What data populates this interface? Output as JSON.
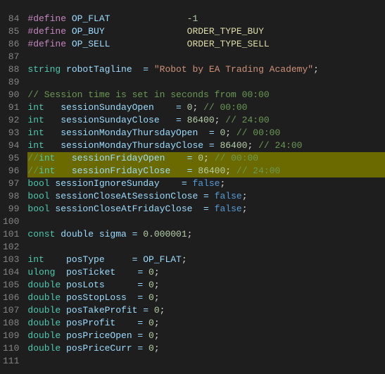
{
  "editor": {
    "background": "#1e1e1e",
    "lines": [
      {
        "num": "",
        "content": []
      },
      {
        "num": "84",
        "content": [
          {
            "t": "#define",
            "c": "preprocessor"
          },
          {
            "t": " OP_FLAT",
            "c": "macro-name"
          },
          {
            "t": "              ",
            "c": ""
          },
          {
            "t": "-1",
            "c": "macro-val"
          }
        ]
      },
      {
        "num": "85",
        "content": [
          {
            "t": "#define",
            "c": "preprocessor"
          },
          {
            "t": " OP_BUY",
            "c": "macro-name"
          },
          {
            "t": "               ",
            "c": ""
          },
          {
            "t": "ORDER_TYPE_BUY",
            "c": "order-type"
          }
        ]
      },
      {
        "num": "86",
        "content": [
          {
            "t": "#define",
            "c": "preprocessor"
          },
          {
            "t": " OP_SELL",
            "c": "macro-name"
          },
          {
            "t": "              ",
            "c": ""
          },
          {
            "t": "ORDER_TYPE_SELL",
            "c": "order-type"
          }
        ]
      },
      {
        "num": "87",
        "content": []
      },
      {
        "num": "88",
        "content": [
          {
            "t": "string",
            "c": "kw-string"
          },
          {
            "t": " robotTagline  = ",
            "c": "var"
          },
          {
            "t": "\"Robot by EA Trading Academy\"",
            "c": "str"
          },
          {
            "t": ";",
            "c": "punct"
          }
        ]
      },
      {
        "num": "89",
        "content": []
      },
      {
        "num": "90",
        "content": [
          {
            "t": "// Session time is set in seconds from 00:00",
            "c": "comment"
          }
        ]
      },
      {
        "num": "91",
        "content": [
          {
            "t": "int",
            "c": "kw-int"
          },
          {
            "t": "   sessionSundayOpen    = ",
            "c": "var"
          },
          {
            "t": "0",
            "c": "num"
          },
          {
            "t": "; ",
            "c": "punct"
          },
          {
            "t": "// 00:00",
            "c": "comment"
          }
        ]
      },
      {
        "num": "92",
        "content": [
          {
            "t": "int",
            "c": "kw-int"
          },
          {
            "t": "   sessionSundayClose   = ",
            "c": "var"
          },
          {
            "t": "86400",
            "c": "num"
          },
          {
            "t": "; ",
            "c": "punct"
          },
          {
            "t": "// 24:00",
            "c": "comment"
          }
        ]
      },
      {
        "num": "93",
        "content": [
          {
            "t": "int",
            "c": "kw-int"
          },
          {
            "t": "   sessionMondayThursdayOpen  = ",
            "c": "var"
          },
          {
            "t": "0",
            "c": "num"
          },
          {
            "t": "; ",
            "c": "punct"
          },
          {
            "t": "// 00:00",
            "c": "comment"
          }
        ]
      },
      {
        "num": "94",
        "content": [
          {
            "t": "int",
            "c": "kw-int"
          },
          {
            "t": "   sessionMondayThursdayClose = ",
            "c": "var"
          },
          {
            "t": "86400",
            "c": "num"
          },
          {
            "t": "; ",
            "c": "punct"
          },
          {
            "t": "// 24:00",
            "c": "comment"
          }
        ]
      },
      {
        "num": "95",
        "highlighted": true,
        "content": [
          {
            "t": "//",
            "c": "comment"
          },
          {
            "t": "int",
            "c": "kw-int"
          },
          {
            "t": "   sessionFridayOpen    = ",
            "c": "var"
          },
          {
            "t": "0",
            "c": "num"
          },
          {
            "t": "; ",
            "c": "punct"
          },
          {
            "t": "// 00:00",
            "c": "comment"
          }
        ]
      },
      {
        "num": "96",
        "highlighted": true,
        "content": [
          {
            "t": "//",
            "c": "comment"
          },
          {
            "t": "int",
            "c": "kw-int"
          },
          {
            "t": "   sessionFridayClose   = ",
            "c": "var"
          },
          {
            "t": "86400",
            "c": "num"
          },
          {
            "t": "; ",
            "c": "punct"
          },
          {
            "t": "// 24:00",
            "c": "comment"
          }
        ]
      },
      {
        "num": "97",
        "content": [
          {
            "t": "bool",
            "c": "kw-bool"
          },
          {
            "t": " sessionIgnoreSunday    = ",
            "c": "var"
          },
          {
            "t": "false",
            "c": "bool-val"
          },
          {
            "t": ";",
            "c": "punct"
          }
        ]
      },
      {
        "num": "98",
        "content": [
          {
            "t": "bool",
            "c": "kw-bool"
          },
          {
            "t": " sessionCloseAtSessionClose = ",
            "c": "var"
          },
          {
            "t": "false",
            "c": "bool-val"
          },
          {
            "t": ";",
            "c": "punct"
          }
        ]
      },
      {
        "num": "99",
        "content": [
          {
            "t": "bool",
            "c": "kw-bool"
          },
          {
            "t": " sessionCloseAtFridayClose  = ",
            "c": "var"
          },
          {
            "t": "false",
            "c": "bool-val"
          },
          {
            "t": ";",
            "c": "punct"
          }
        ]
      },
      {
        "num": "100",
        "content": []
      },
      {
        "num": "101",
        "content": [
          {
            "t": "const",
            "c": "kw-const"
          },
          {
            "t": " double sigma = ",
            "c": "var"
          },
          {
            "t": "0.000001",
            "c": "num"
          },
          {
            "t": ";",
            "c": "punct"
          }
        ]
      },
      {
        "num": "102",
        "content": []
      },
      {
        "num": "103",
        "content": [
          {
            "t": "int",
            "c": "kw-int"
          },
          {
            "t": "    posType     = ",
            "c": "var"
          },
          {
            "t": "OP_FLAT",
            "c": "macro-name"
          },
          {
            "t": ";",
            "c": "punct"
          }
        ]
      },
      {
        "num": "104",
        "content": [
          {
            "t": "ulong",
            "c": "kw-ulong"
          },
          {
            "t": "  posTicket    = ",
            "c": "var"
          },
          {
            "t": "0",
            "c": "num"
          },
          {
            "t": ";",
            "c": "punct"
          }
        ]
      },
      {
        "num": "105",
        "content": [
          {
            "t": "double",
            "c": "kw-double"
          },
          {
            "t": " posLots      = ",
            "c": "var"
          },
          {
            "t": "0",
            "c": "num"
          },
          {
            "t": ";",
            "c": "punct"
          }
        ]
      },
      {
        "num": "106",
        "content": [
          {
            "t": "double",
            "c": "kw-double"
          },
          {
            "t": " posStopLoss  = ",
            "c": "var"
          },
          {
            "t": "0",
            "c": "num"
          },
          {
            "t": ";",
            "c": "punct"
          }
        ]
      },
      {
        "num": "107",
        "content": [
          {
            "t": "double",
            "c": "kw-double"
          },
          {
            "t": " posTakeProfit = ",
            "c": "var"
          },
          {
            "t": "0",
            "c": "num"
          },
          {
            "t": ";",
            "c": "punct"
          }
        ]
      },
      {
        "num": "108",
        "content": [
          {
            "t": "double",
            "c": "kw-double"
          },
          {
            "t": " posProfit    = ",
            "c": "var"
          },
          {
            "t": "0",
            "c": "num"
          },
          {
            "t": ";",
            "c": "punct"
          }
        ]
      },
      {
        "num": "109",
        "content": [
          {
            "t": "double",
            "c": "kw-double"
          },
          {
            "t": " posPriceOpen = ",
            "c": "var"
          },
          {
            "t": "0",
            "c": "num"
          },
          {
            "t": ";",
            "c": "punct"
          }
        ]
      },
      {
        "num": "110",
        "content": [
          {
            "t": "double",
            "c": "kw-double"
          },
          {
            "t": " posPriceCurr = ",
            "c": "var"
          },
          {
            "t": "0",
            "c": "num"
          },
          {
            "t": ";",
            "c": "punct"
          }
        ]
      },
      {
        "num": "111",
        "content": []
      }
    ]
  }
}
